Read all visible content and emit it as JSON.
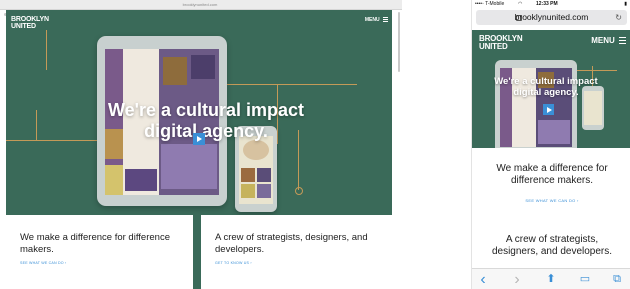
{
  "desktop": {
    "url": "brooklynunited.com",
    "logo": {
      "line1": "BROOKLYN",
      "line2": "UNITED"
    },
    "menu_label": "MENU",
    "hero_title": "We're a cultural impact digital agency.",
    "cards": [
      {
        "text": "We make a difference for difference makers.",
        "link": "SEE WHAT WE CAN DO ›"
      },
      {
        "text": "A crew of strategists, designers, and developers.",
        "link": "GET TO KNOW US ›"
      }
    ]
  },
  "mobile": {
    "status": {
      "carrier": "••••◦ T-Mobile",
      "wifi": "◠",
      "time": "12:33 PM",
      "battery": "▮"
    },
    "url": "brooklynunited.com",
    "reload_icon": "↻",
    "logo": {
      "line1": "BROOKLYN",
      "line2": "UNITED"
    },
    "menu_label": "MENU",
    "hero_title": "We're a cultural impact digital agency.",
    "text1": "We make a difference for difference makers.",
    "link1": "SEE WHAT WE CAN DO ›",
    "text2": "A crew of strategists, designers, and developers.",
    "toolbar": {
      "back": "‹",
      "forward": "›",
      "share": "⬆",
      "bookmarks": "▭",
      "tabs": "⧉"
    }
  },
  "colors": {
    "brand_green": "#3a6a59",
    "accent_blue": "#3a8fd6",
    "wire_gold": "#c49a58"
  }
}
